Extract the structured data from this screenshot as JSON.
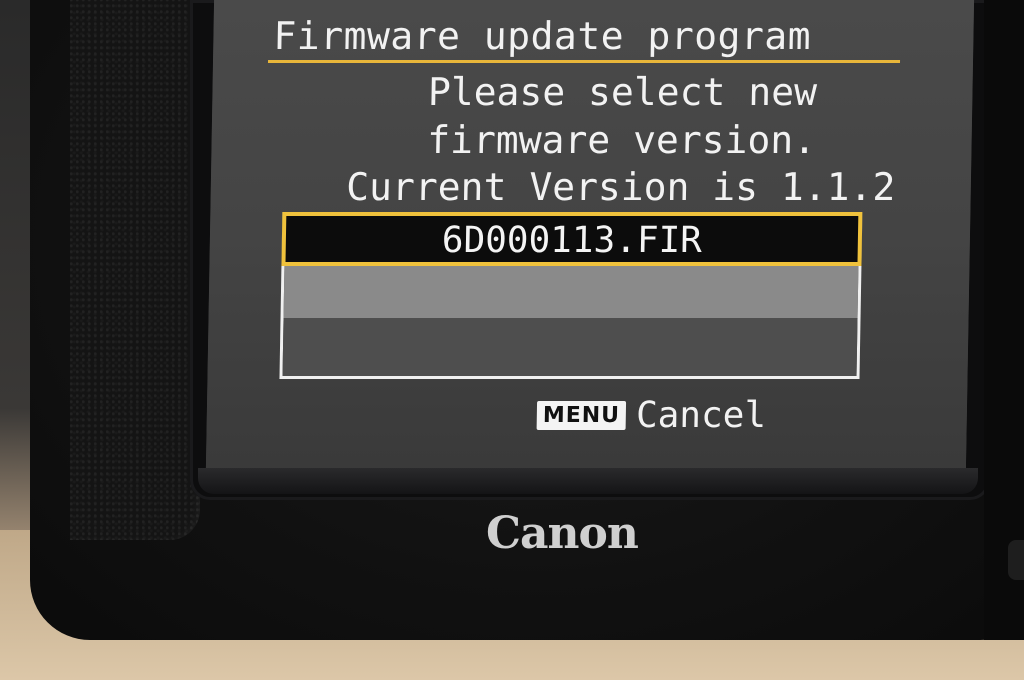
{
  "screen": {
    "title": "Firmware update program",
    "prompt_line1": "Please select new",
    "prompt_line2": "firmware version.",
    "current_version": "Current Version is 1.1.2",
    "files": [
      {
        "name": "6D000113.FIR",
        "selected": true
      },
      {
        "name": "",
        "selected": false
      },
      {
        "name": "",
        "selected": false
      }
    ],
    "menu_key_label": "MENU",
    "cancel_label": "Cancel"
  },
  "device": {
    "brand": "Canon"
  },
  "colors": {
    "highlight": "#f0c23c",
    "screen_bg": "#444444",
    "text": "#f2f2f2"
  }
}
